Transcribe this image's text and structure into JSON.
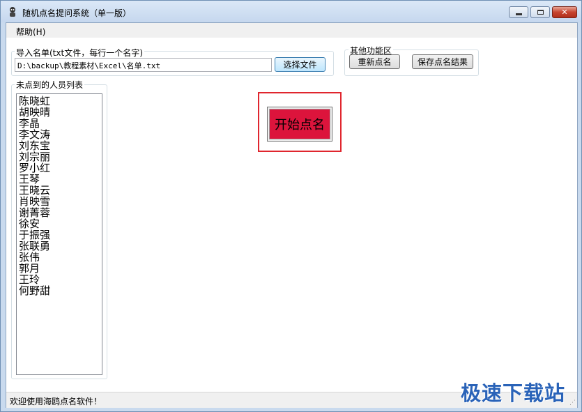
{
  "window": {
    "title": "随机点名提问系统（单一版）",
    "controls": {
      "minimize": "▭",
      "maximize": "□",
      "close": "✕"
    }
  },
  "menu": {
    "help": "帮助(H)"
  },
  "import_group": {
    "title": "导入名单(txt文件，每行一个名字)",
    "file_path": "D:\\backup\\教程素材\\Excel\\名单.txt",
    "choose_file_label": "选择文件"
  },
  "other_group": {
    "title": "其他功能区",
    "reset_label": "重新点名",
    "save_label": "保存点名结果"
  },
  "absent_group": {
    "title": "未点到的人员列表",
    "names": [
      "陈晓虹",
      "胡映晴",
      "李晶",
      "李文涛",
      "刘东宝",
      "刘宗丽",
      "罗小红",
      "王琴",
      "王晓云",
      "肖映雪",
      "谢菁蓉",
      "徐安",
      "于振强",
      "张联勇",
      "张伟",
      "郭月",
      "王玲",
      "何野甜"
    ]
  },
  "main": {
    "start_label": "开始点名"
  },
  "status": {
    "text": "欢迎使用海鸥点名软件！"
  },
  "watermark": {
    "text": "极速下载站"
  },
  "colors": {
    "start_button": "#dc143c",
    "highlight": "#e0262e"
  },
  "icons": {
    "app": "app-icon"
  }
}
